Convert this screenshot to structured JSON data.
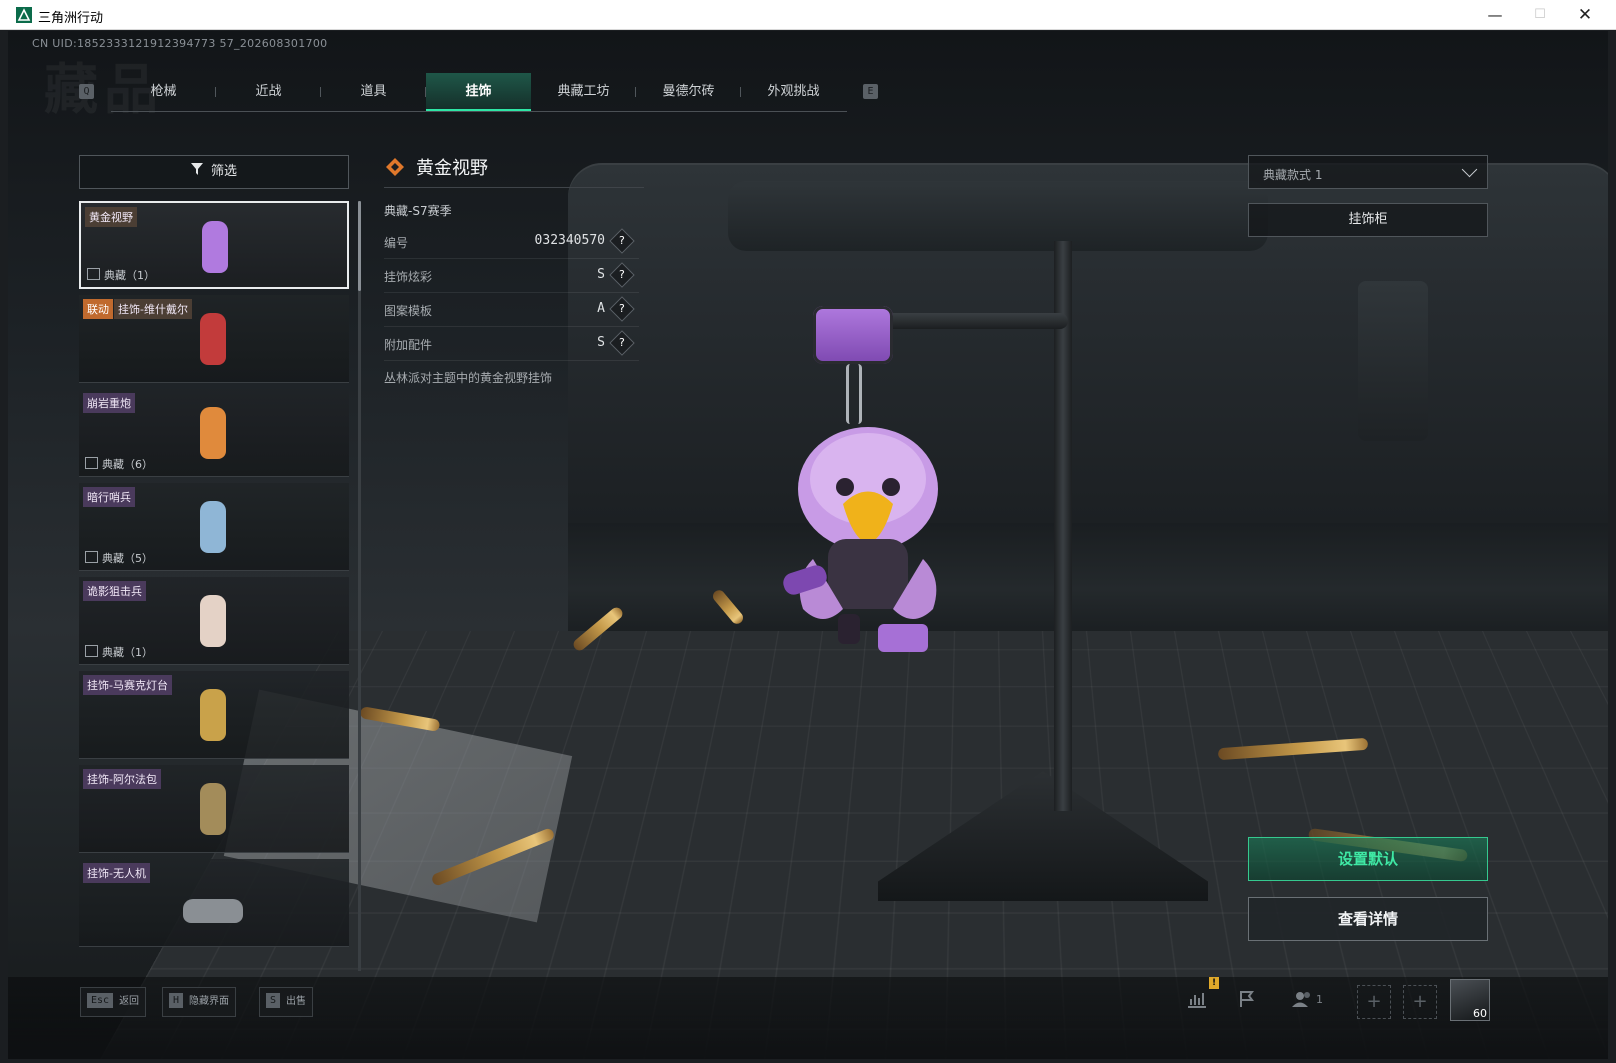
{
  "window": {
    "title": "三角洲行动",
    "controls": {
      "minimize": "—",
      "maximize": "☐",
      "close": "✕"
    }
  },
  "uid_text": "CN UID:1852333121912394773 57_202608301700",
  "ghost_title": "藏品",
  "tabs": {
    "key_left": "Q",
    "key_right": "E",
    "items": [
      "枪械",
      "近战",
      "道具",
      "挂饰",
      "典藏工坊",
      "曼德尔砖",
      "外观挑战"
    ],
    "active": "挂饰"
  },
  "filter": {
    "label": "筛选",
    "icon": "filter-funnel-icon"
  },
  "items": [
    {
      "tags": [
        "黄金视野"
      ],
      "rarity": "典藏（1）",
      "selected": true,
      "thumb_color": "#b07adf"
    },
    {
      "tags": [
        "联动",
        "挂饰-维什戴尔"
      ],
      "rarity": "",
      "thumb_color": "#c23b3b"
    },
    {
      "tags": [
        "崩岩重炮"
      ],
      "rarity": "典藏（6）",
      "thumb_color": "#e08a3c"
    },
    {
      "tags": [
        "暗行哨兵"
      ],
      "rarity": "典藏（5）",
      "thumb_color": "#8fb6d6"
    },
    {
      "tags": [
        "诡影狙击兵"
      ],
      "rarity": "典藏（1）",
      "thumb_color": "#e4d2c6"
    },
    {
      "tags": [
        "挂饰-马赛克灯台"
      ],
      "rarity": "",
      "thumb_color": "#c9a24a"
    },
    {
      "tags": [
        "挂饰-阿尔法包"
      ],
      "rarity": "",
      "thumb_color": "#a38c5a"
    },
    {
      "tags": [
        "挂饰-无人机"
      ],
      "rarity": "",
      "thumb_color": "#8a8f94"
    }
  ],
  "detail": {
    "icon": "orange-diamond-icon",
    "name": "黄金视野",
    "season": "典藏-S7赛季",
    "rows": [
      {
        "key": "编号",
        "value": "032340570"
      },
      {
        "key": "挂饰炫彩",
        "value": "S"
      },
      {
        "key": "图案模板",
        "value": "A"
      },
      {
        "key": "附加配件",
        "value": "S"
      }
    ],
    "help_glyph": "?",
    "description": "丛林派对主题中的黄金视野挂饰"
  },
  "style_select": {
    "value": "典藏款式 1"
  },
  "cabinet_button": "挂饰柜",
  "set_default_button": "设置默认",
  "view_details_button": "查看详情",
  "bottom_hints": [
    {
      "key": "Esc",
      "label": "返回"
    },
    {
      "key": "H",
      "label": "隐藏界面"
    },
    {
      "key": "S",
      "label": "出售"
    }
  ],
  "bottom_right": {
    "warn_glyph": "!",
    "icons": [
      "stats-icon",
      "flag-icon",
      "friends-icon"
    ],
    "friends_count": "1",
    "add_glyph": "+",
    "level": "60"
  },
  "colors": {
    "accent_green": "#2ee6a6",
    "tag_purple": "#4a3a5c",
    "collab_orange": "#c06a2e"
  }
}
